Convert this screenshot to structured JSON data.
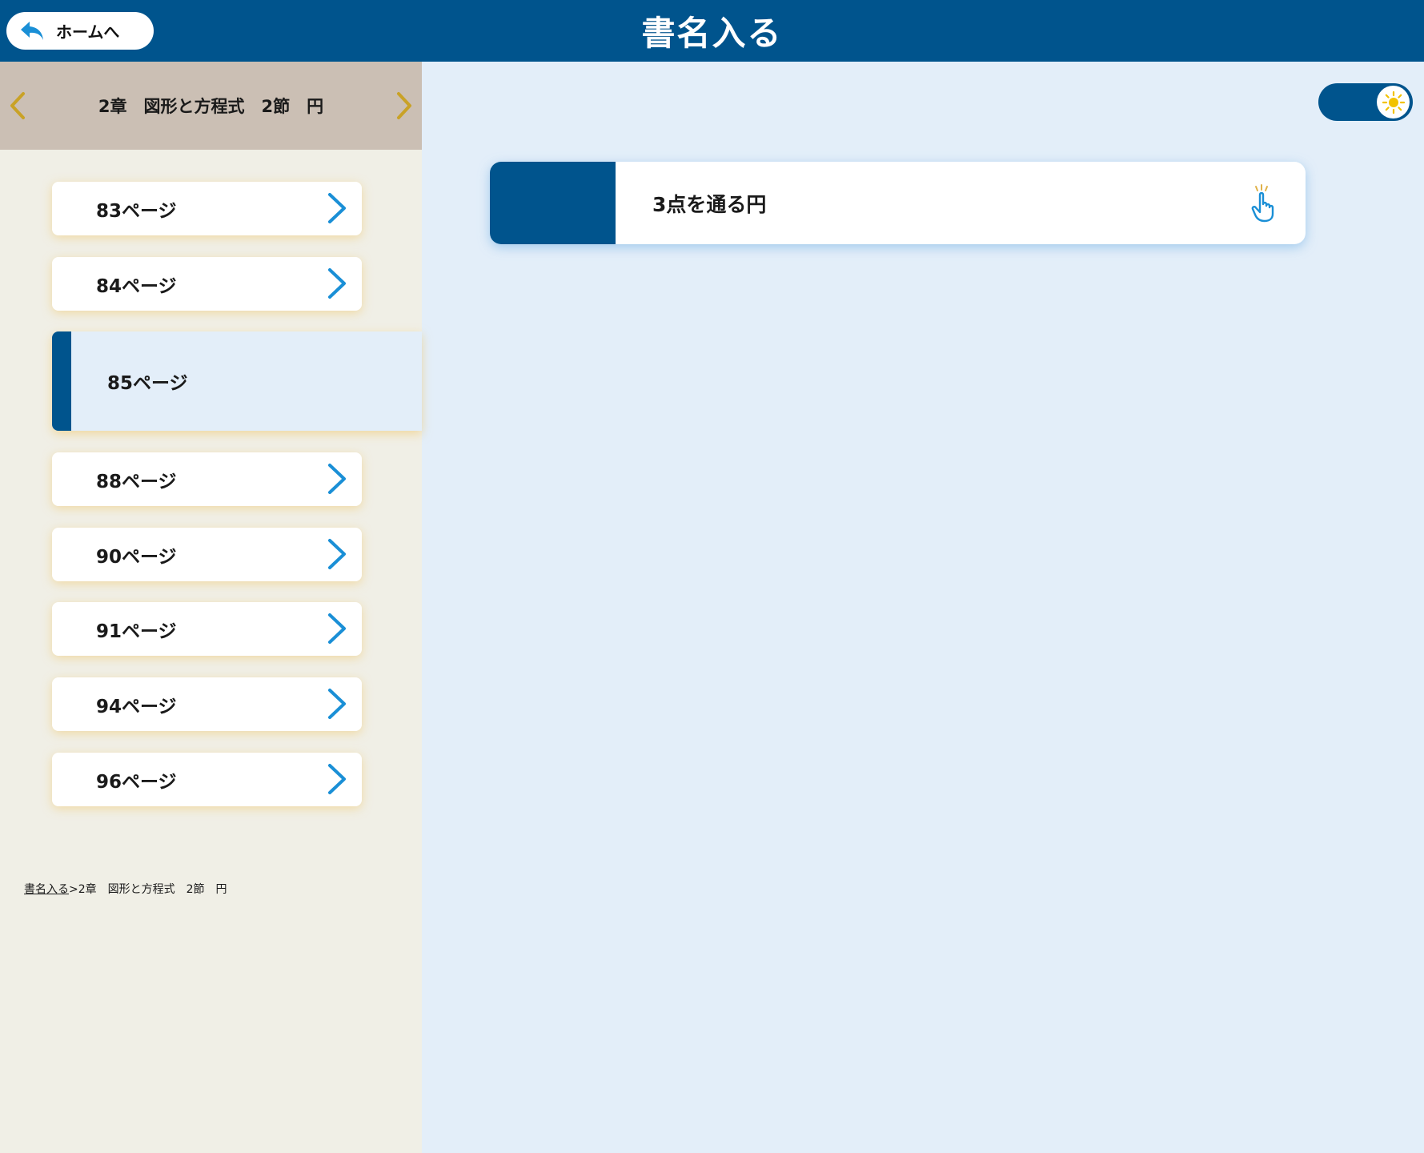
{
  "header": {
    "home_label": "ホームへ",
    "app_title": "書名入る"
  },
  "sidebar": {
    "chapter_title": "2章　図形と方程式　2節　円",
    "pages": [
      {
        "label": "83ページ"
      },
      {
        "label": "84ページ"
      },
      {
        "label": "85ページ",
        "active": true
      },
      {
        "label": "88ページ"
      },
      {
        "label": "90ページ"
      },
      {
        "label": "91ページ"
      },
      {
        "label": "94ページ"
      },
      {
        "label": "96ページ"
      }
    ],
    "breadcrumb": {
      "root": "書名入る",
      "separator": ">",
      "current": "2章　図形と方程式　2節　円"
    }
  },
  "main": {
    "theme_toggle_icon": "sun-icon",
    "items": [
      {
        "label": "3点を通る円",
        "icon": "tap-hand-icon"
      }
    ]
  },
  "colors": {
    "primary": "#00548d",
    "accent_chevron": "#c9a227",
    "arrow": "#1a8fd6",
    "sidebar_bg": "#f0efe6",
    "chapter_bg": "#cbbfb4",
    "main_bg": "#e3eef9"
  }
}
